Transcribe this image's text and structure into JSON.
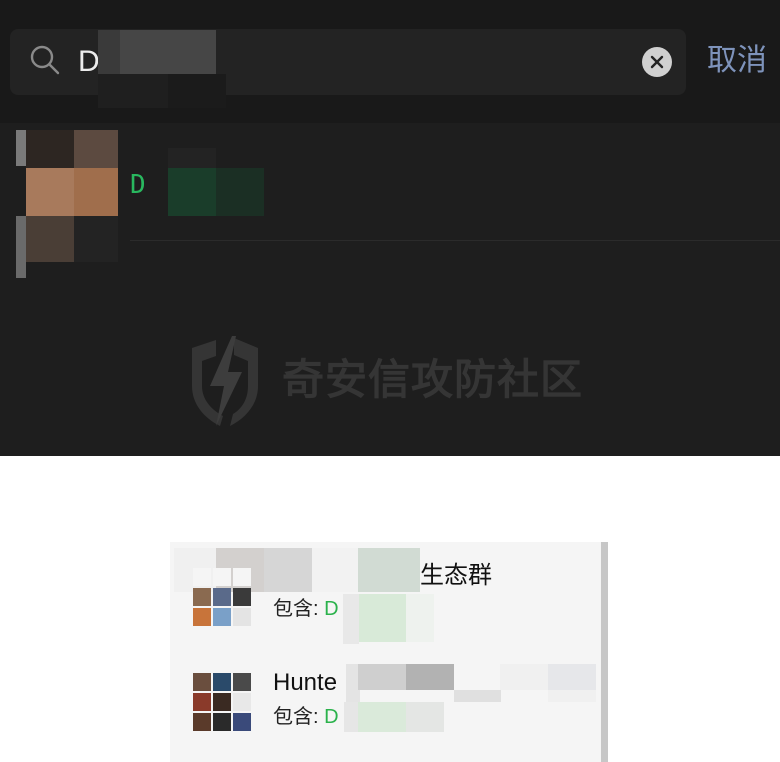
{
  "search": {
    "query": "D",
    "cancel_label": "取消"
  },
  "result": {
    "snippet": "D"
  },
  "watermark": {
    "text": "奇安信攻防社区"
  },
  "groups": [
    {
      "name_visible": "生态群",
      "contains_label": "包含:",
      "contains_value": "D"
    },
    {
      "name_visible": "Hunte",
      "contains_label": "包含:",
      "contains_value": "D"
    }
  ],
  "colors": {
    "accent_green": "#2bb24c",
    "cancel_blue": "#7e93bb",
    "dark_bg": "#1e1e1e"
  }
}
